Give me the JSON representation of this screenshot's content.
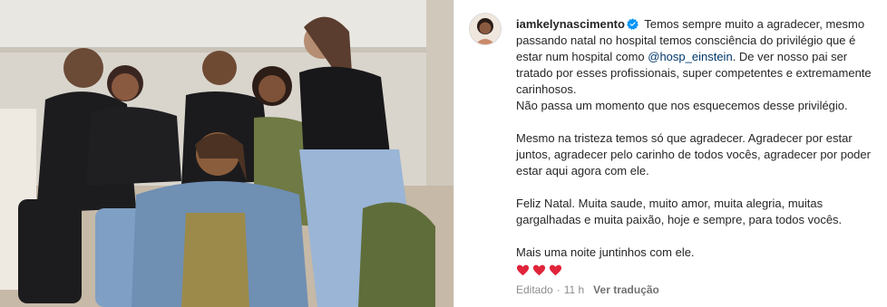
{
  "post": {
    "username": "iamkelynascimento",
    "caption_1": "Temos sempre muito a agradecer, mesmo passando natal no hospital temos consciência do privilégio que é estar num hospital como",
    "mention": "@hosp_einstein",
    "caption_2": ". De ver nosso pai ser tratado por esses profissionais, super competentes e extremamente carinhosos.",
    "caption_3": "Não passa um momento que nos esquecemos desse privilégio.",
    "caption_4": "Mesmo na tristeza temos só que agradecer. Agradecer por estar juntos, agradecer pelo carinho de todos vocês, agradecer por poder estar aqui agora com ele.",
    "caption_5": "Feliz Natal. Muita saude, muito amor, muita alegria, muitas gargalhadas e muita paixão, hoje e sempre, para todos vocês.",
    "caption_6": "Mais uma noite juntinhos com ele.",
    "hearts": [
      "heart-emoji",
      "heart-emoji",
      "heart-emoji"
    ],
    "edited_label": "Editado",
    "age": "11 h",
    "translate_label": "Ver tradução"
  },
  "colors": {
    "link": "#00376b",
    "verified": "#0095f6",
    "muted": "#8e8e8e",
    "heart": "#e0243a"
  }
}
